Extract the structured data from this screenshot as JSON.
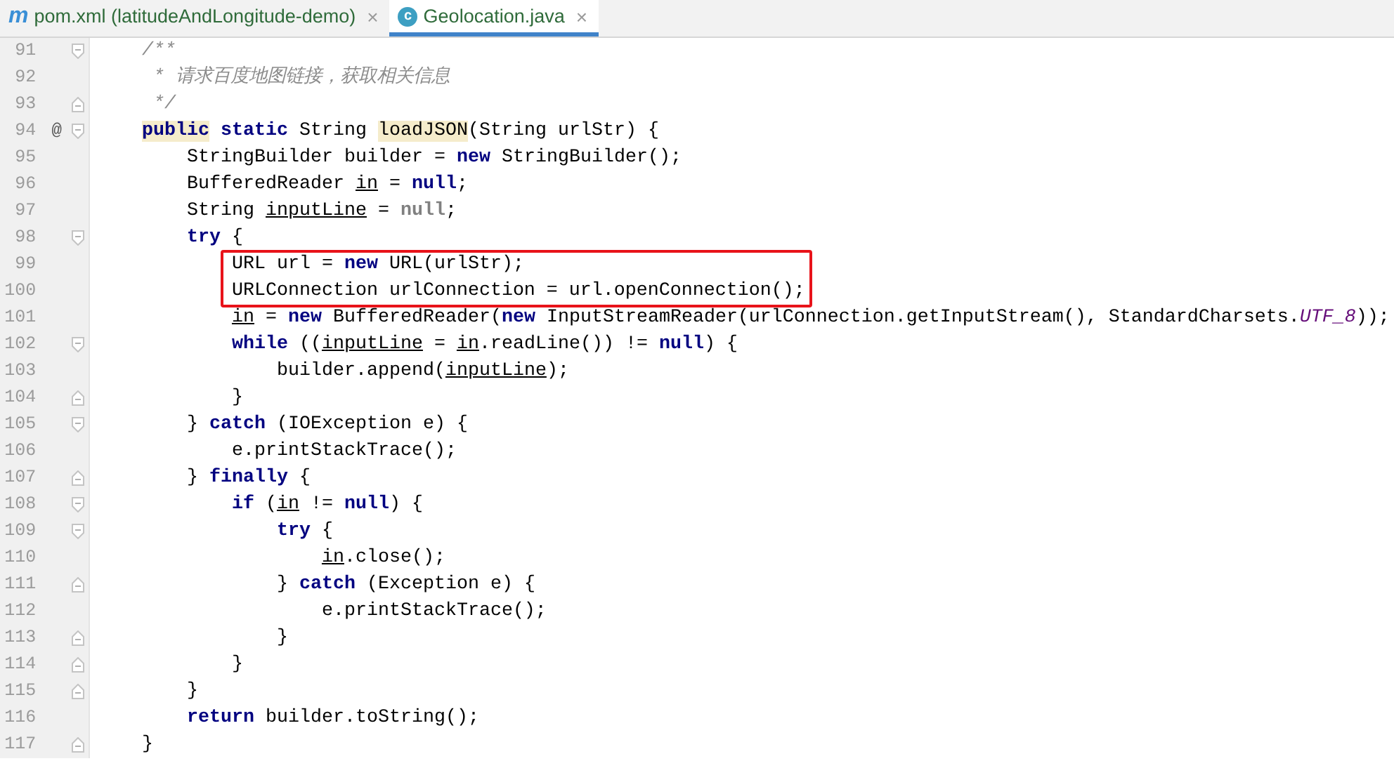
{
  "tabs": [
    {
      "icon": "m",
      "kind": "maven",
      "label": "pom.xml (latitudeAndLongitude-demo)",
      "close": "×",
      "selected": false
    },
    {
      "icon": "c",
      "kind": "java",
      "label": "Geolocation.java",
      "close": "×",
      "selected": true
    }
  ],
  "code_lines": [
    {
      "number": "91",
      "fold_start": true,
      "fold_end": false,
      "boxed": false,
      "tokens": [
        {
          "kind": "comment",
          "text": "    /**"
        }
      ]
    },
    {
      "number": "92",
      "fold_start": false,
      "fold_end": false,
      "boxed": false,
      "tokens": [
        {
          "kind": "comment",
          "text": "     * 请求百度地图链接，获取相关信息"
        }
      ]
    },
    {
      "number": "93",
      "fold_start": false,
      "fold_end": true,
      "boxed": false,
      "tokens": [
        {
          "kind": "comment",
          "text": "     */"
        }
      ]
    },
    {
      "number": "94",
      "mark": "@",
      "fold_start": true,
      "fold_end": false,
      "boxed": false,
      "tokens": [
        {
          "kind": "keyword-marked",
          "text": "    public"
        },
        {
          "kind": "keyword",
          "text": " static"
        },
        {
          "kind": "plain",
          "text": " String "
        },
        {
          "kind": "marked",
          "text": "loadJSON"
        },
        {
          "kind": "plain",
          "text": "(String urlStr) {"
        }
      ]
    },
    {
      "number": "95",
      "fold_start": false,
      "fold_end": false,
      "boxed": false,
      "tokens": [
        {
          "kind": "plain",
          "text": "        StringBuilder builder = "
        },
        {
          "kind": "keyword",
          "text": "new"
        },
        {
          "kind": "plain",
          "text": " StringBuilder();"
        }
      ]
    },
    {
      "number": "96",
      "fold_start": false,
      "fold_end": false,
      "boxed": false,
      "tokens": [
        {
          "kind": "plain",
          "text": "        BufferedReader "
        },
        {
          "kind": "variable",
          "text": "in"
        },
        {
          "kind": "plain",
          "text": " = "
        },
        {
          "kind": "keyword",
          "text": "null"
        },
        {
          "kind": "plain",
          "text": ";"
        }
      ]
    },
    {
      "number": "97",
      "fold_start": false,
      "fold_end": false,
      "boxed": false,
      "tokens": [
        {
          "kind": "plain",
          "text": "        String "
        },
        {
          "kind": "variable",
          "text": "inputLine"
        },
        {
          "kind": "plain",
          "text": " = "
        },
        {
          "kind": "unused",
          "text": "null"
        },
        {
          "kind": "plain",
          "text": ";"
        }
      ]
    },
    {
      "number": "98",
      "fold_start": true,
      "fold_end": false,
      "boxed": false,
      "tokens": [
        {
          "kind": "keyword",
          "text": "        try"
        },
        {
          "kind": "plain",
          "text": " {"
        }
      ]
    },
    {
      "number": "99",
      "fold_start": false,
      "fold_end": false,
      "boxed": true,
      "tokens": [
        {
          "kind": "plain",
          "text": "            URL url = "
        },
        {
          "kind": "keyword",
          "text": "new"
        },
        {
          "kind": "plain",
          "text": " URL(urlStr);"
        }
      ]
    },
    {
      "number": "100",
      "fold_start": false,
      "fold_end": false,
      "boxed": true,
      "tokens": [
        {
          "kind": "plain",
          "text": "            URLConnection urlConnection = url.openConnection();"
        }
      ]
    },
    {
      "number": "101",
      "fold_start": false,
      "fold_end": false,
      "boxed": false,
      "tokens": [
        {
          "kind": "variable",
          "text": "            in"
        },
        {
          "kind": "plain",
          "text": " = "
        },
        {
          "kind": "keyword",
          "text": "new"
        },
        {
          "kind": "plain",
          "text": " BufferedReader("
        },
        {
          "kind": "keyword",
          "text": "new"
        },
        {
          "kind": "plain",
          "text": " InputStreamReader(urlConnection.getInputStream(), StandardCharsets."
        },
        {
          "kind": "field",
          "text": "UTF_8"
        },
        {
          "kind": "plain",
          "text": "));"
        }
      ]
    },
    {
      "number": "102",
      "fold_start": true,
      "fold_end": false,
      "boxed": false,
      "tokens": [
        {
          "kind": "keyword",
          "text": "            while"
        },
        {
          "kind": "plain",
          "text": " (("
        },
        {
          "kind": "variable",
          "text": "inputLine"
        },
        {
          "kind": "plain",
          "text": " = "
        },
        {
          "kind": "variable",
          "text": "in"
        },
        {
          "kind": "plain",
          "text": ".readLine()) != "
        },
        {
          "kind": "keyword",
          "text": "null"
        },
        {
          "kind": "plain",
          "text": ") {"
        }
      ]
    },
    {
      "number": "103",
      "fold_start": false,
      "fold_end": false,
      "boxed": false,
      "tokens": [
        {
          "kind": "plain",
          "text": "                builder.append("
        },
        {
          "kind": "variable",
          "text": "inputLine"
        },
        {
          "kind": "plain",
          "text": ");"
        }
      ]
    },
    {
      "number": "104",
      "fold_start": false,
      "fold_end": true,
      "boxed": false,
      "tokens": [
        {
          "kind": "plain",
          "text": "            }"
        }
      ]
    },
    {
      "number": "105",
      "fold_start": true,
      "fold_end": false,
      "boxed": false,
      "tokens": [
        {
          "kind": "plain",
          "text": "        } "
        },
        {
          "kind": "keyword",
          "text": "catch"
        },
        {
          "kind": "plain",
          "text": " (IOException e) {"
        }
      ]
    },
    {
      "number": "106",
      "fold_start": false,
      "fold_end": false,
      "boxed": false,
      "tokens": [
        {
          "kind": "plain",
          "text": "            e.printStackTrace();"
        }
      ]
    },
    {
      "number": "107",
      "fold_start": false,
      "fold_end": true,
      "boxed": false,
      "tokens": [
        {
          "kind": "plain",
          "text": "        } "
        },
        {
          "kind": "keyword",
          "text": "finally"
        },
        {
          "kind": "plain",
          "text": " {"
        }
      ]
    },
    {
      "number": "108",
      "fold_start": true,
      "fold_end": false,
      "boxed": false,
      "tokens": [
        {
          "kind": "keyword",
          "text": "            if"
        },
        {
          "kind": "plain",
          "text": " ("
        },
        {
          "kind": "variable",
          "text": "in"
        },
        {
          "kind": "plain",
          "text": " != "
        },
        {
          "kind": "keyword",
          "text": "null"
        },
        {
          "kind": "plain",
          "text": ") {"
        }
      ]
    },
    {
      "number": "109",
      "fold_start": true,
      "fold_end": false,
      "boxed": false,
      "tokens": [
        {
          "kind": "keyword",
          "text": "                try"
        },
        {
          "kind": "plain",
          "text": " {"
        }
      ]
    },
    {
      "number": "110",
      "fold_start": false,
      "fold_end": false,
      "boxed": false,
      "tokens": [
        {
          "kind": "variable",
          "text": "                    in"
        },
        {
          "kind": "plain",
          "text": ".close();"
        }
      ]
    },
    {
      "number": "111",
      "fold_start": false,
      "fold_end": true,
      "boxed": false,
      "tokens": [
        {
          "kind": "plain",
          "text": "                } "
        },
        {
          "kind": "keyword",
          "text": "catch"
        },
        {
          "kind": "plain",
          "text": " (Exception e) {"
        }
      ]
    },
    {
      "number": "112",
      "fold_start": false,
      "fold_end": false,
      "boxed": false,
      "tokens": [
        {
          "kind": "plain",
          "text": "                    e.printStackTrace();"
        }
      ]
    },
    {
      "number": "113",
      "fold_start": false,
      "fold_end": true,
      "boxed": false,
      "tokens": [
        {
          "kind": "plain",
          "text": "                }"
        }
      ]
    },
    {
      "number": "114",
      "fold_start": false,
      "fold_end": true,
      "boxed": false,
      "tokens": [
        {
          "kind": "plain",
          "text": "            }"
        }
      ]
    },
    {
      "number": "115",
      "fold_start": false,
      "fold_end": true,
      "boxed": false,
      "tokens": [
        {
          "kind": "plain",
          "text": "        }"
        }
      ]
    },
    {
      "number": "116",
      "fold_start": false,
      "fold_end": false,
      "boxed": false,
      "tokens": [
        {
          "kind": "keyword",
          "text": "        return"
        },
        {
          "kind": "plain",
          "text": " builder.toString();"
        }
      ]
    },
    {
      "number": "117",
      "fold_start": false,
      "fold_end": true,
      "boxed": false,
      "tokens": [
        {
          "kind": "plain",
          "text": "    }"
        }
      ]
    }
  ]
}
